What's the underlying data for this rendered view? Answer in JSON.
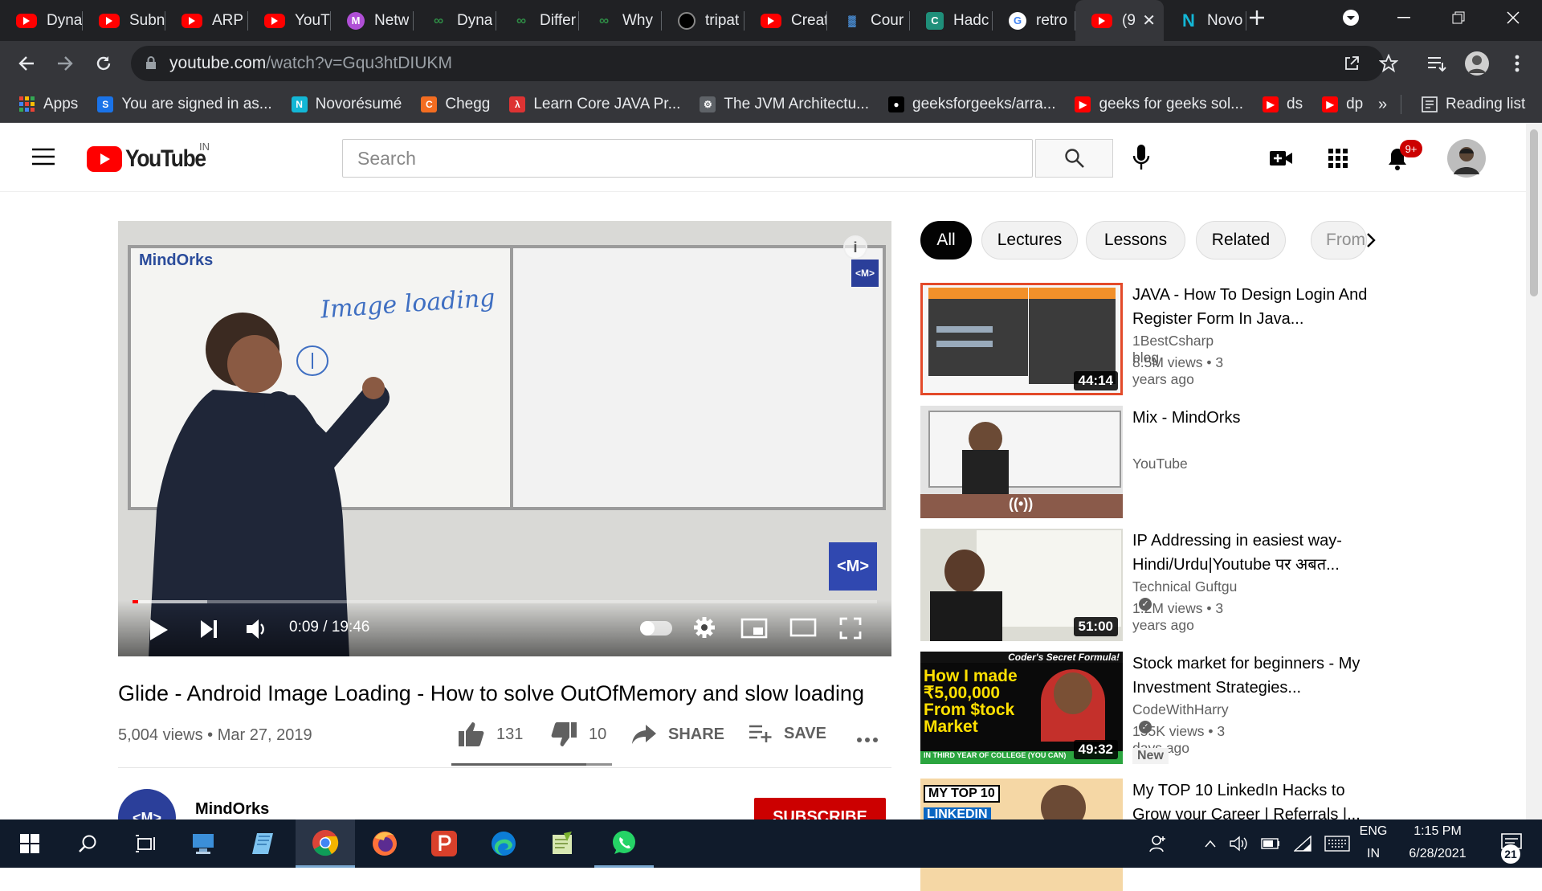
{
  "browser": {
    "tabs": [
      {
        "title": "Dyna",
        "icon": "youtube-icon",
        "type": "yt"
      },
      {
        "title": "Subn",
        "icon": "youtube-icon",
        "type": "yt"
      },
      {
        "title": "ARP |",
        "icon": "youtube-icon",
        "type": "yt"
      },
      {
        "title": "YouT",
        "icon": "youtube-icon",
        "type": "yt"
      },
      {
        "title": "Netw",
        "icon": "m-icon",
        "type": "m"
      },
      {
        "title": "Dyna",
        "icon": "gfg-icon",
        "type": "gfg"
      },
      {
        "title": "Differ",
        "icon": "gfg-icon",
        "type": "gfg"
      },
      {
        "title": "Why",
        "icon": "gfg-icon",
        "type": "gfg"
      },
      {
        "title": "tripat",
        "icon": "github-icon",
        "type": "gh"
      },
      {
        "title": "Creat",
        "icon": "youtube-icon",
        "type": "yt"
      },
      {
        "title": "Cour",
        "icon": "chart-icon",
        "type": "bar"
      },
      {
        "title": "Hadc",
        "icon": "c-icon",
        "type": "c"
      },
      {
        "title": "retro",
        "icon": "google-icon",
        "type": "g"
      },
      {
        "title": "(9",
        "icon": "youtube-icon",
        "type": "yt",
        "active": true
      },
      {
        "title": "Novo",
        "icon": "n-icon",
        "type": "n"
      }
    ],
    "url_host": "youtube.com",
    "url_path": "/watch?v=Gqu3htDIUKM",
    "bookmarks": [
      {
        "label": "Apps",
        "color": "#ea4335",
        "icon": "apps-icon"
      },
      {
        "label": "You are signed in as...",
        "color": "#1a73e8",
        "glyph": "S",
        "icon": "s-icon"
      },
      {
        "label": "Novorésumé",
        "color": "#13b7d6",
        "glyph": "N",
        "icon": "n-icon"
      },
      {
        "label": "Chegg",
        "color": "#f36d21",
        "glyph": "C",
        "icon": "chegg-icon"
      },
      {
        "label": "Learn Core JAVA Pr...",
        "color": "#d33",
        "glyph": "λ",
        "icon": "java-icon"
      },
      {
        "label": "The JVM Architectu...",
        "color": "#5f6368",
        "glyph": "⚙",
        "icon": "jvm-icon"
      },
      {
        "label": "geeksforgeeks/arra...",
        "color": "#000",
        "glyph": "●",
        "icon": "github-icon"
      },
      {
        "label": "geeks for geeks sol...",
        "color": "#f00",
        "glyph": "▶",
        "icon": "youtube-icon"
      },
      {
        "label": "ds",
        "color": "#f00",
        "glyph": "▶",
        "icon": "youtube-icon"
      },
      {
        "label": "dp",
        "color": "#f00",
        "glyph": "▶",
        "icon": "youtube-icon"
      }
    ],
    "more_bookmarks": "»",
    "reading_list": "Reading list"
  },
  "youtube": {
    "logo_text": "YouTube",
    "region": "IN",
    "search_placeholder": "Search",
    "notifications": "9+",
    "video": {
      "time": "0:09 / 19:46",
      "progress": 0.008,
      "buffered": 0.1,
      "brand": "MindOrks",
      "board_text": "Image loading",
      "title": "Glide - Android Image Loading - How to solve OutOfMemory and slow loading",
      "views": "5,004 views • Mar 27, 2019",
      "likes": "131",
      "dislikes": "10",
      "share": "SHARE",
      "save": "SAVE",
      "channel": "MindOrks",
      "subscribe": "SUBSCRIBE"
    },
    "chips": [
      "All",
      "Lectures",
      "Lessons",
      "Related",
      "From"
    ],
    "related": [
      {
        "title": "JAVA - How To Design Login And Register Form In Java...",
        "channel": "1BestCsharp blog",
        "meta": "8.5M views • 3 years ago",
        "duration": "44:14",
        "verified": false
      },
      {
        "title": "Mix - MindOrks",
        "channel": "YouTube",
        "meta": "",
        "duration": "",
        "verified": false
      },
      {
        "title": "IP Addressing in easiest way-Hindi/Urdu|Youtube पर अबत...",
        "channel": "Technical Guftgu",
        "meta": "1.2M views • 3 years ago",
        "duration": "51:00",
        "verified": true
      },
      {
        "title": "Stock market for beginners - My Investment Strategies...",
        "channel": "CodeWithHarry",
        "meta": "155K views • 3 days ago",
        "duration": "49:32",
        "verified": true,
        "badge": "New",
        "thumb_text": "How I made ₹5,00,000 From $tock Market",
        "thumb_top": "Coder's Secret Formula!",
        "thumb_bottom": "IN THIRD YEAR OF COLLEGE (YOU CAN)"
      },
      {
        "title": "My TOP 10 LinkedIn Hacks to Grow your Career | Referrals |...",
        "channel": "",
        "meta": "",
        "duration": "",
        "thumb_text": "MY TOP 10",
        "thumb_text2": "LINKEDIN"
      }
    ]
  },
  "taskbar": {
    "lang": "ENG",
    "region": "IN",
    "time": "1:15 PM",
    "date": "6/28/2021",
    "notifications": "21"
  }
}
